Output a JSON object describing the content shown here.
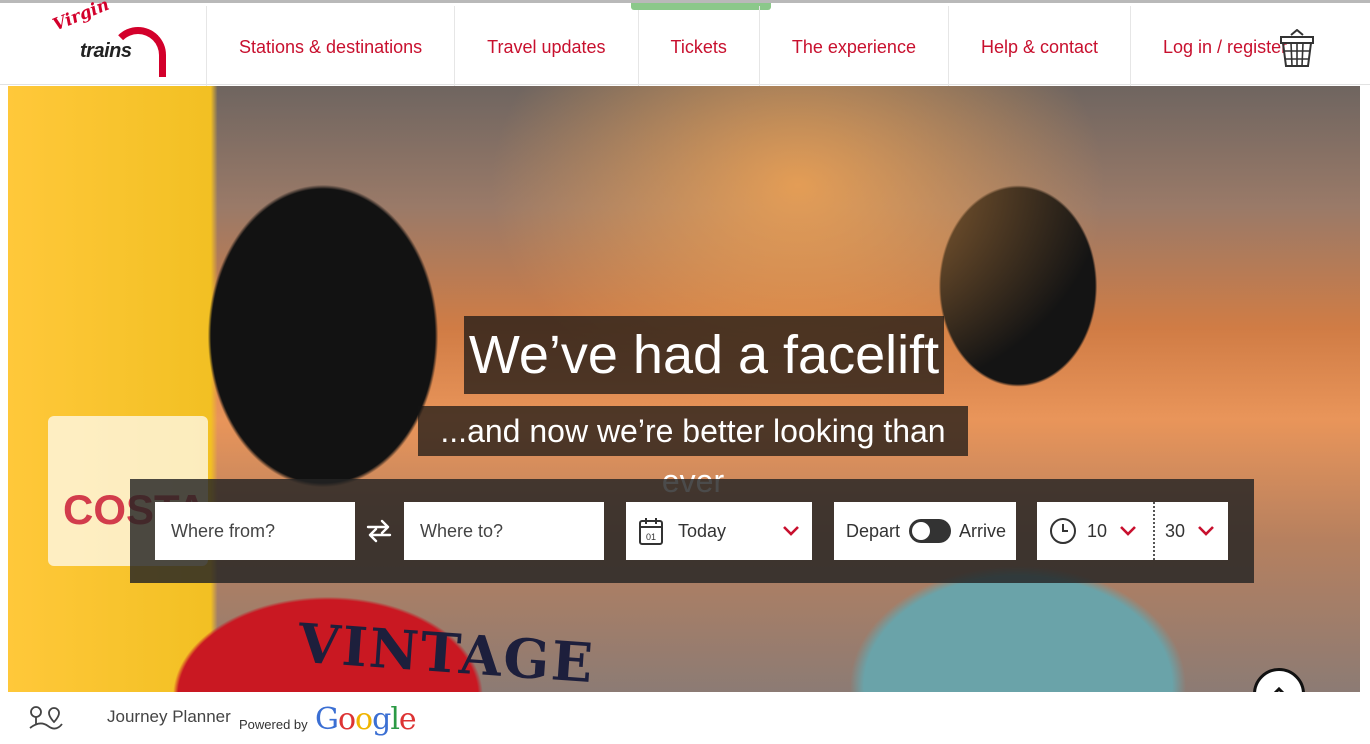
{
  "brand": {
    "line1": "Virgin",
    "line2": "trains"
  },
  "nav": {
    "items": [
      {
        "label": "Stations & destinations"
      },
      {
        "label": "Travel updates"
      },
      {
        "label": "Tickets"
      },
      {
        "label": "The experience"
      },
      {
        "label": "Help & contact"
      },
      {
        "label": "Log in / register"
      }
    ],
    "active_item": "Tickets"
  },
  "hero": {
    "headline": "We’ve had a facelift",
    "subline": "...and now we’re better looking than ever",
    "background_text": {
      "sign": "COSTA",
      "shirt": "VINTAGE"
    }
  },
  "search": {
    "from_placeholder": "Where from?",
    "to_placeholder": "Where to?",
    "date_value": "Today",
    "calendar_day": "01",
    "depart_label": "Depart",
    "arrive_label": "Arrive",
    "hour": "10",
    "minute": "30"
  },
  "footer": {
    "journey_planner": "Journey Planner",
    "powered_by": "Powered by",
    "google": [
      "G",
      "o",
      "o",
      "g",
      "l",
      "e"
    ]
  },
  "colors": {
    "accent": "#c8102e",
    "active_tab": "#8bc88a",
    "panel": "#232323"
  }
}
